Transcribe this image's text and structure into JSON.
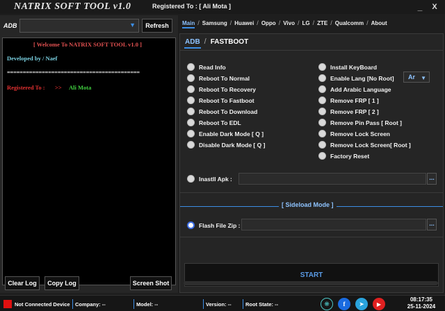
{
  "title": {
    "app_name": "NATRIX SOFT TOOL v1.0",
    "registered_label": "Registered To :",
    "registered_value": "[ Ali Mota ]",
    "minimize": "_",
    "close": "X"
  },
  "left": {
    "adb_label": "ADB",
    "adb_value": "",
    "refresh_label": "Refresh",
    "log": {
      "welcome": "[ Welcome To NATRIX SOFT TOOL v1.0 ]",
      "developer": "Developed by /  Naef",
      "separator": "==========================================",
      "registered_label": "Registered To :",
      "registered_arrows": ">>",
      "registered_value": "Ali Mota"
    },
    "clear_log": "Clear Log",
    "copy_log": "Copy Log",
    "screenshot": "Screen Shot"
  },
  "tabs": [
    "Main",
    "Samsung",
    "Huawei",
    "Oppo",
    "Vivo",
    "LG",
    "ZTE",
    "Qualcomm",
    "About"
  ],
  "active_tab": "Main",
  "subtabs": [
    "ADB",
    "FASTBOOT"
  ],
  "active_subtab": "ADB",
  "options_left": [
    "Read Info",
    "Reboot To Normal",
    "Reboot To Recovery",
    "Reboot To Fastboot",
    "Reboot To Download",
    "Reboot To EDL",
    "Enable Dark Mode [ Q ]",
    "Disable Dark Mode [ Q ]"
  ],
  "options_right": [
    "Install KeyBoard",
    "Enable Lang [No Root]",
    "Add Arabic Language",
    "Remove FRP [ 1 ]",
    "Remove FRP [ 2 ]",
    "Remove Pin Pass [ Root ]",
    "Remove Lock Screen",
    "Remove Lock Screen[ Root ]",
    "Factory Reset"
  ],
  "lang_select": "Ar",
  "install_apk_label": "Inastll Apk :",
  "install_apk_value": "",
  "browse_label": "...",
  "sideload_title": "[ Sideload Mode ]",
  "flash_label": "Flash File Zip :",
  "flash_value": "",
  "start_label": "START",
  "progress": 0,
  "status": {
    "connection": "Not Connected Device",
    "company": "Company: --",
    "model": "Model: --",
    "version": "Version: --",
    "root": "Root State: --",
    "time": "08:17:35",
    "date": "25-11-2024"
  },
  "colors": {
    "accent": "#3c8ee6",
    "disconnected": "#e01010",
    "log_red": "#e03030",
    "log_green": "#40d040",
    "log_cyan": "#7ad0e0"
  },
  "social_icons": [
    "opensource-icon",
    "facebook-icon",
    "telegram-icon",
    "youtube-icon"
  ]
}
